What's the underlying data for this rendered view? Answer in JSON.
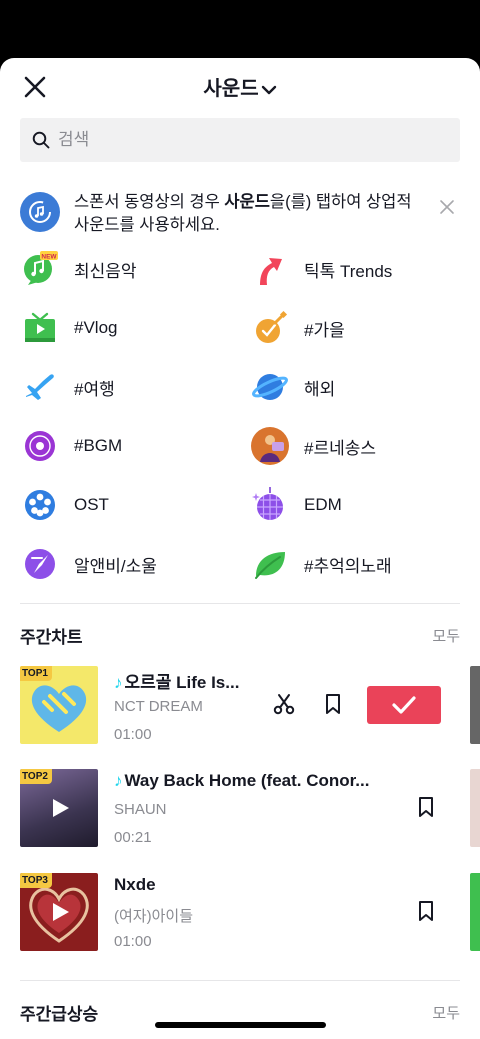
{
  "header": {
    "title": "사운드"
  },
  "search": {
    "placeholder": "검색"
  },
  "banner": {
    "text_before": "스폰서 동영상의 경우 ",
    "text_bold": "사운드",
    "text_after": "을(를) 탭하여 상업적 사운드를 사용하세요."
  },
  "categories": [
    {
      "label": "최신음악",
      "icon": "new-music-icon"
    },
    {
      "label": "틱톡 Trends",
      "icon": "trend-arrow-icon"
    },
    {
      "label": "#Vlog",
      "icon": "tv-icon"
    },
    {
      "label": "#가을",
      "icon": "guitar-icon"
    },
    {
      "label": "#여행",
      "icon": "airplane-icon"
    },
    {
      "label": "해외",
      "icon": "planet-icon"
    },
    {
      "label": "#BGM",
      "icon": "vinyl-icon"
    },
    {
      "label": "#르네송스",
      "icon": "renaissance-icon"
    },
    {
      "label": "OST",
      "icon": "film-reel-icon"
    },
    {
      "label": "EDM",
      "icon": "disco-ball-icon"
    },
    {
      "label": "알앤비/소울",
      "icon": "compass-icon"
    },
    {
      "label": "#추억의노래",
      "icon": "leaf-icon"
    }
  ],
  "weekly_chart": {
    "title": "주간차트",
    "more": "모두",
    "tracks": [
      {
        "rank": "TOP1",
        "title": "오르골 Life Is...",
        "artist": "NCT DREAM",
        "duration": "01:00"
      },
      {
        "rank": "TOP2",
        "title": "Way Back Home (feat. Conor...",
        "artist": "SHAUN",
        "duration": "00:21"
      },
      {
        "rank": "TOP3",
        "title": "Nxde",
        "artist": "(여자)아이들",
        "duration": "01:00"
      }
    ]
  },
  "weekly_rising": {
    "title": "주간급상승",
    "more": "모두"
  },
  "colors": {
    "accent": "#ea4359",
    "note": "#20d5ec",
    "rank_badge": "#f5c842"
  }
}
